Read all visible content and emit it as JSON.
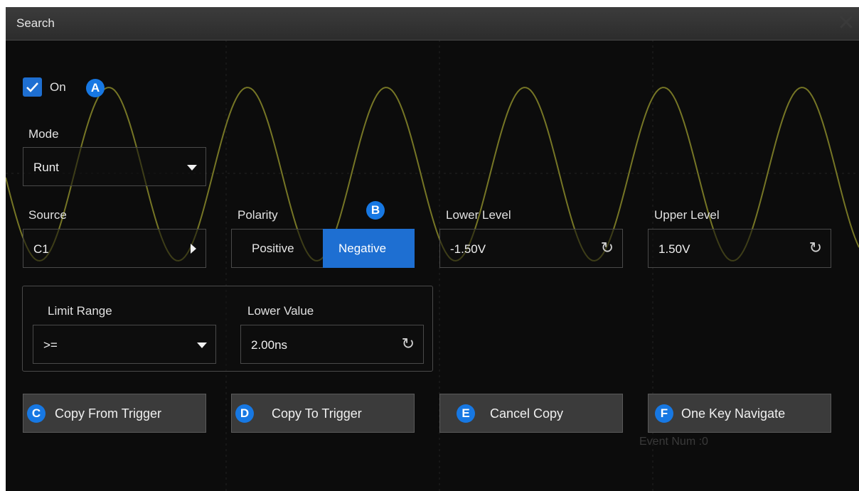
{
  "window": {
    "title": "Search",
    "close_icon": "close-icon"
  },
  "on_toggle": {
    "label": "On",
    "checked": true,
    "badge": "A"
  },
  "mode": {
    "label": "Mode",
    "value": "Runt"
  },
  "source": {
    "label": "Source",
    "value": "C1"
  },
  "polarity": {
    "label": "Polarity",
    "badge": "B",
    "options": [
      "Positive",
      "Negative"
    ],
    "selected": "Negative"
  },
  "lower_level": {
    "label": "Lower Level",
    "value": "-1.50V"
  },
  "upper_level": {
    "label": "Upper Level",
    "value": "1.50V"
  },
  "limit_range": {
    "label": "Limit Range",
    "value": ">="
  },
  "lower_value": {
    "label": "Lower Value",
    "value": "2.00ns"
  },
  "buttons": [
    {
      "badge": "C",
      "label": "Copy From Trigger"
    },
    {
      "badge": "D",
      "label": "Copy To Trigger"
    },
    {
      "badge": "E",
      "label": "Cancel Copy"
    },
    {
      "badge": "F",
      "label": "One Key Navigate"
    }
  ],
  "event_num": "Event Num :0",
  "colors": {
    "accent": "#1778e3",
    "waveform": "#8a8a2a",
    "background": "#0c0c0c"
  }
}
